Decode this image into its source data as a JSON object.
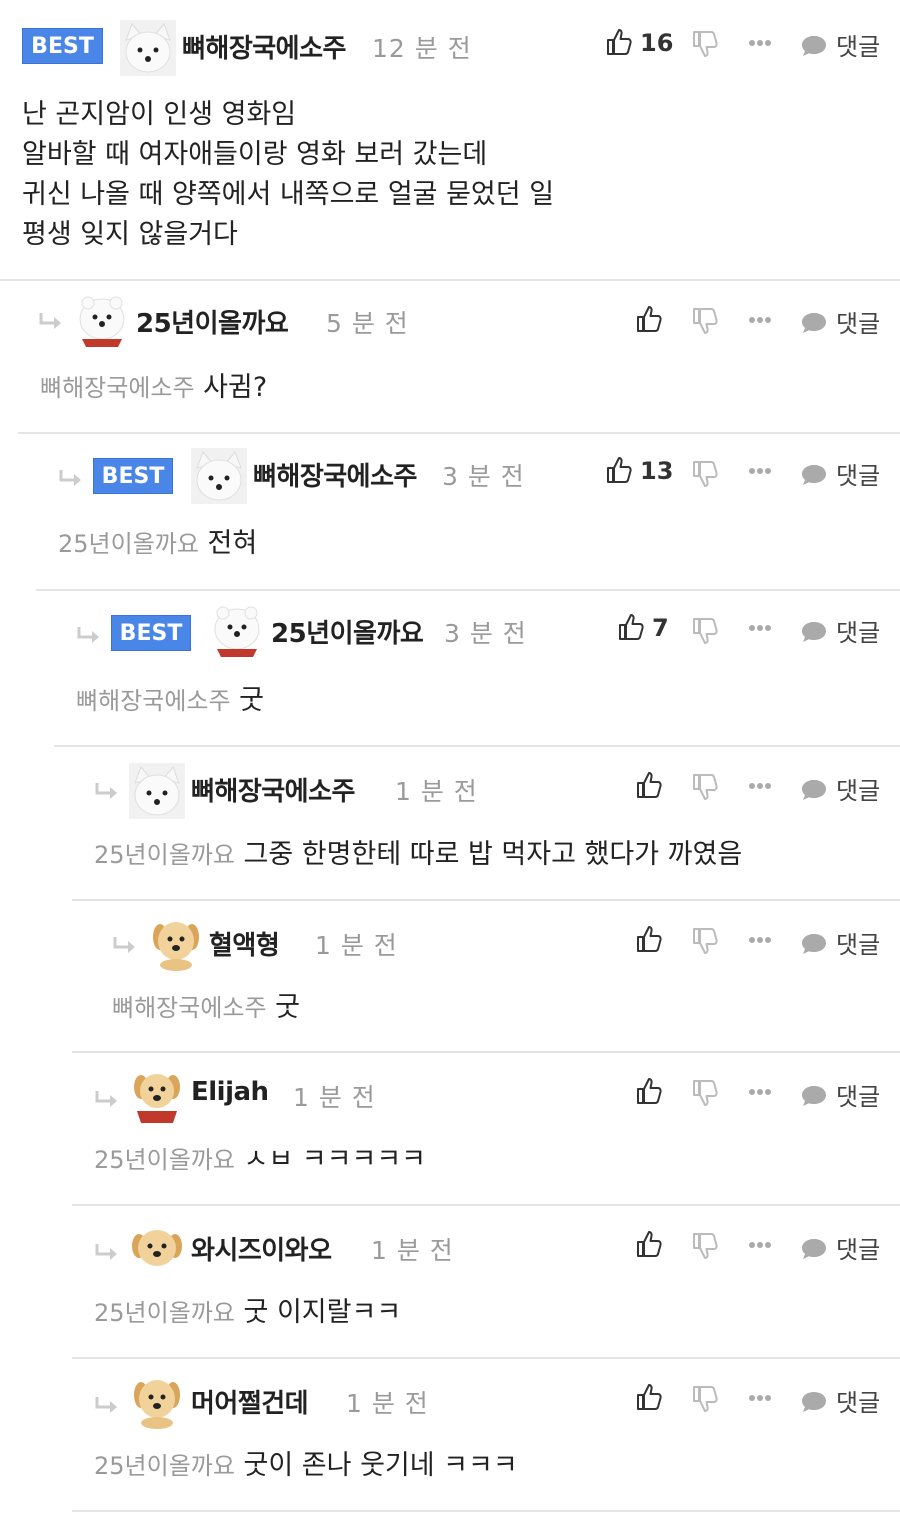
{
  "ui": {
    "reply_label": "댓글",
    "best_label": "BEST"
  },
  "comments": [
    {
      "nick": "뼈해장국에소주",
      "time": "12 분 전",
      "likes": "16",
      "best": true,
      "lines": [
        "난 곤지암이 인생 영화임",
        "알바할 때 여자애들이랑 영화 보러 갔는데",
        "귀신 나올 때 양쪽에서 내쪽으로 얼굴 묻었던 일",
        "평생 잊지 않을거다"
      ]
    },
    {
      "nick": "25년이올까요",
      "time": "5 분 전",
      "mention": "뼈해장국에소주",
      "text": "사귐?"
    },
    {
      "nick": "뼈해장국에소주",
      "time": "3 분 전",
      "likes": "13",
      "best": true,
      "mention": "25년이올까요",
      "text": "전혀"
    },
    {
      "nick": "25년이올까요",
      "time": "3 분 전",
      "likes": "7",
      "best": true,
      "mention": "뼈해장국에소주",
      "text": "굿"
    },
    {
      "nick": "뼈해장국에소주",
      "time": "1 분 전",
      "mention": "25년이올까요",
      "text": "그중 한명한테 따로 밥 먹자고 했다가 까였음"
    },
    {
      "nick": "혈액형",
      "time": "1 분 전",
      "mention": "뼈해장국에소주",
      "text": "굿"
    },
    {
      "nick": "Elijah",
      "time": "1 분 전",
      "mention": "25년이올까요",
      "text": "ㅅㅂ ㅋㅋㅋㅋㅋ"
    },
    {
      "nick": "와시즈이와오",
      "time": "1 분 전",
      "mention": "25년이올까요",
      "text": "굿 이지랄ㅋㅋ"
    },
    {
      "nick": "머어쩔건데",
      "time": "1 분 전",
      "mention": "25년이올까요",
      "text": "굿이 존나 웃기네 ㅋㅋㅋ"
    }
  ],
  "colors": {
    "best_badge": "#4a86e8",
    "muted": "#9a9a9a",
    "separator": "#e4e4e4"
  }
}
